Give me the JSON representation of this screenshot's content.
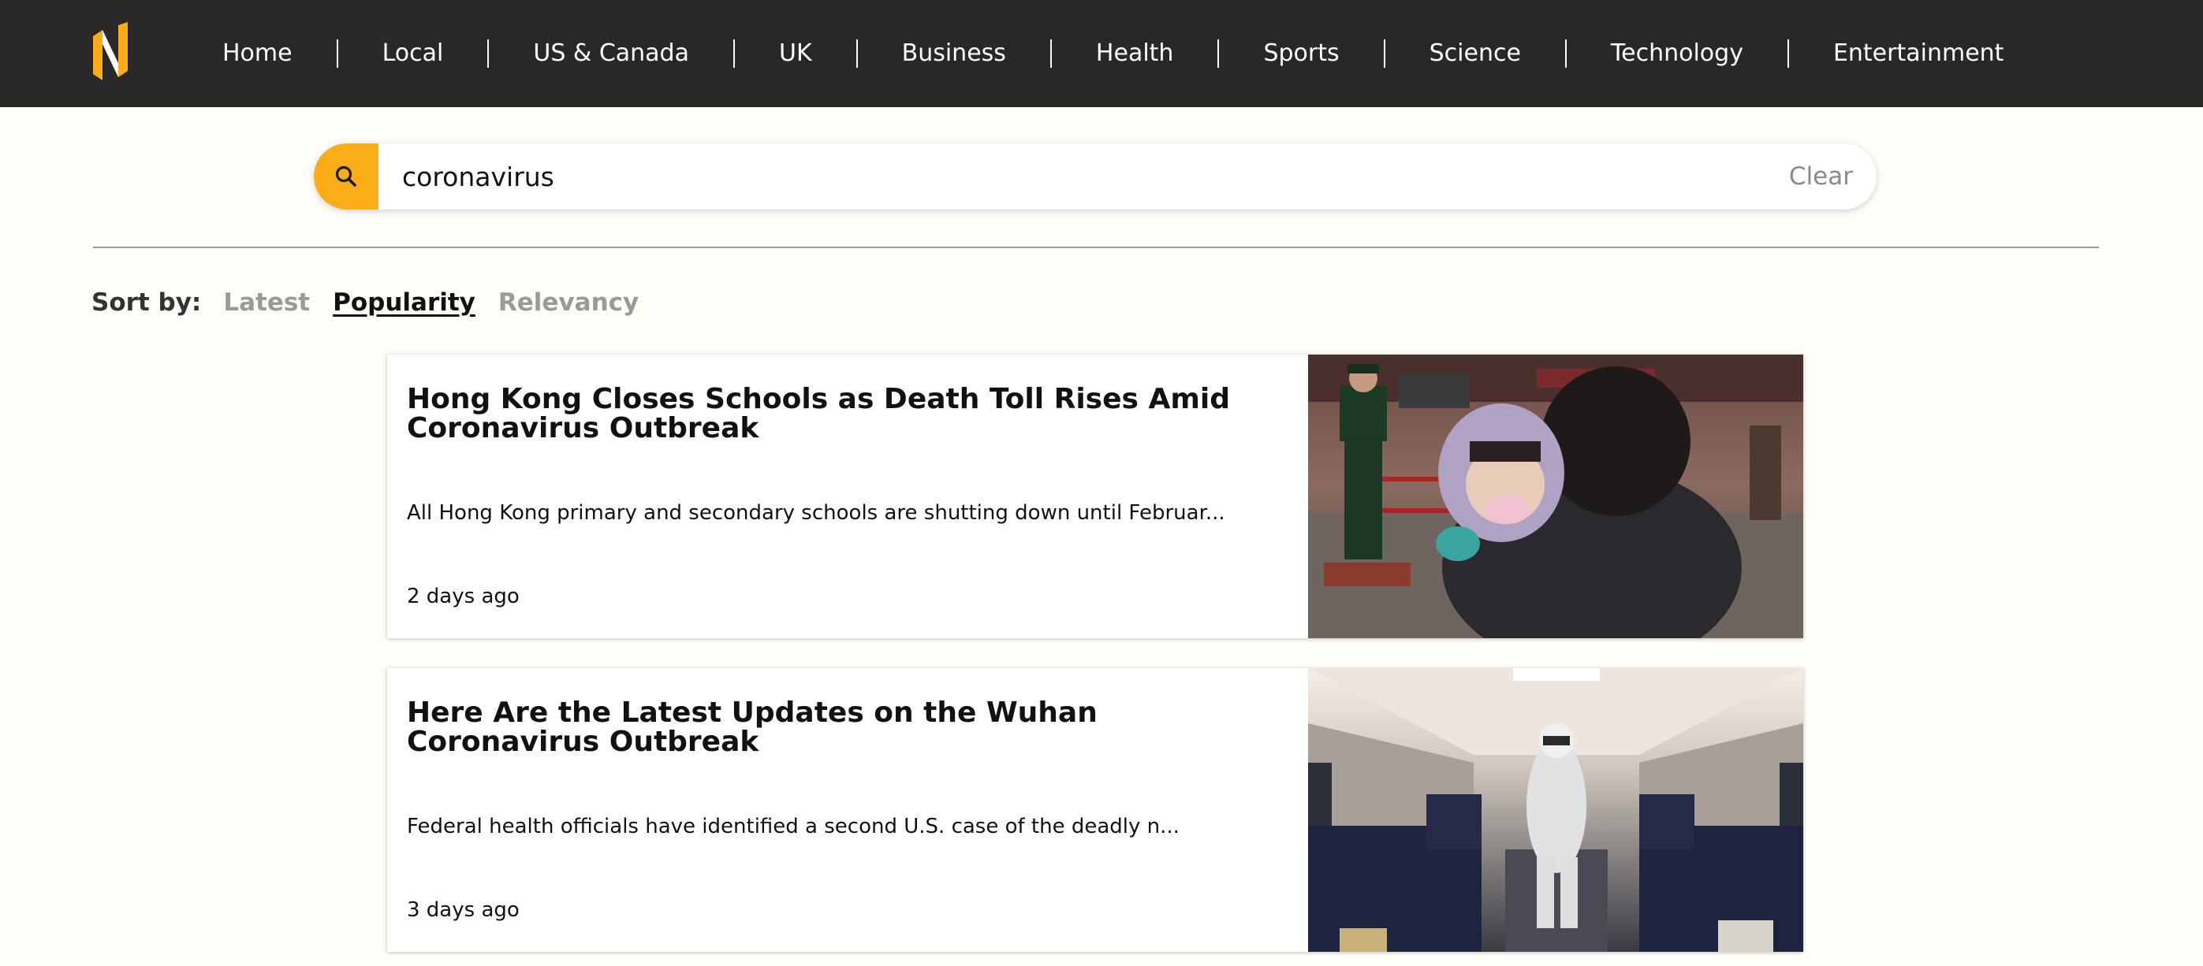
{
  "nav": {
    "items": [
      "Home",
      "Local",
      "US & Canada",
      "UK",
      "Business",
      "Health",
      "Sports",
      "Science",
      "Technology",
      "Entertainment"
    ]
  },
  "search": {
    "value": "coronavirus",
    "clear_label": "Clear"
  },
  "sort": {
    "label": "Sort by:",
    "options": [
      "Latest",
      "Popularity",
      "Relevancy"
    ],
    "active": "Popularity"
  },
  "articles": [
    {
      "title": "Hong Kong Closes Schools as Death Toll Rises Amid Coronavirus Outbreak",
      "description": "All Hong Kong primary and secondary schools are shutting down until Februar...",
      "time": "2 days ago",
      "image": "photo-child-in-mask-at-station-entrance"
    },
    {
      "title": "Here Are the Latest Updates on the Wuhan Coronavirus Outbreak",
      "description": "Federal health officials have identified a second U.S. case of the deadly n...",
      "time": "3 days ago",
      "image": "photo-worker-disinfecting-train-carriage"
    }
  ],
  "colors": {
    "accent": "#fbad18",
    "topbar": "#282828",
    "background": "#fffdf7"
  }
}
